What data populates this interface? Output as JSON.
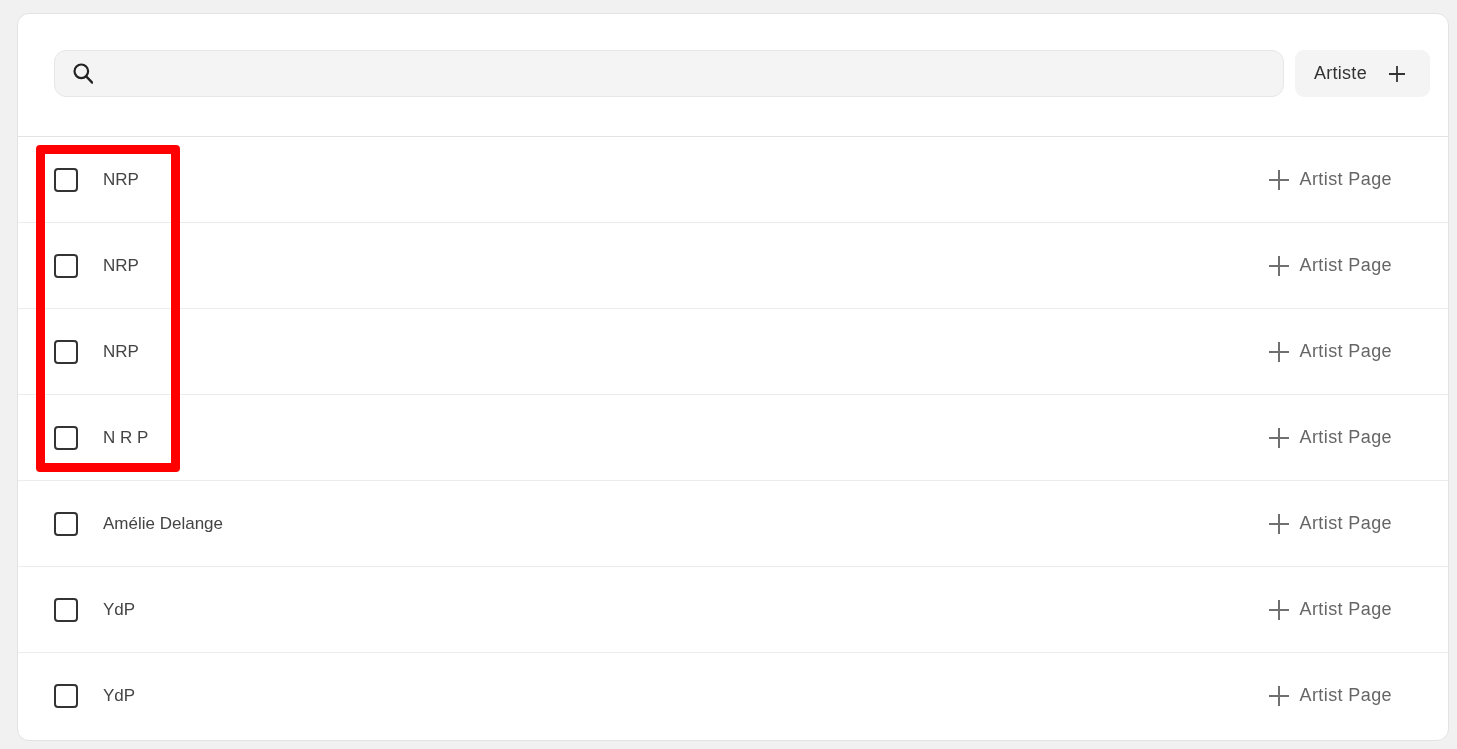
{
  "toolbar": {
    "add_button": {
      "label": "Artiste"
    }
  },
  "rows": [
    {
      "name": "NRP",
      "checked": false,
      "highlighted": true,
      "action": "Artist Page"
    },
    {
      "name": "NRP",
      "checked": false,
      "highlighted": true,
      "action": "Artist Page"
    },
    {
      "name": "NRP",
      "checked": false,
      "highlighted": true,
      "action": "Artist Page"
    },
    {
      "name": "N R P",
      "checked": false,
      "highlighted": true,
      "action": "Artist Page"
    },
    {
      "name": "Amélie Delange",
      "checked": false,
      "highlighted": false,
      "action": "Artist Page"
    },
    {
      "name": "YdP",
      "checked": false,
      "highlighted": false,
      "action": "Artist Page"
    },
    {
      "name": "YdP",
      "checked": false,
      "highlighted": false,
      "action": "Artist Page"
    }
  ]
}
